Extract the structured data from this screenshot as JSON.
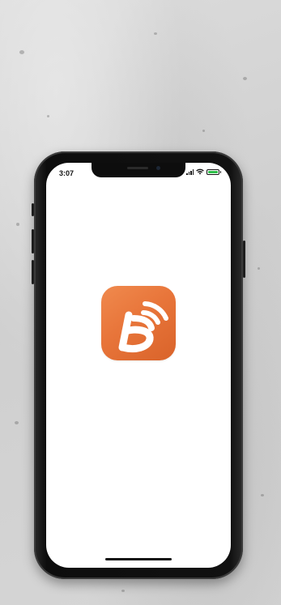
{
  "status_bar": {
    "time": "3:07",
    "signal_icon": "cellular-signal-icon",
    "wifi_icon": "wifi-icon",
    "battery_icon": "battery-charging-icon"
  },
  "app": {
    "icon_name": "app-logo-d-signal-icon",
    "icon_color": "#E8753A"
  },
  "colors": {
    "screen_background": "#FFFFFF",
    "phone_frame": "#111111",
    "battery_fill": "#2FBF4A"
  }
}
